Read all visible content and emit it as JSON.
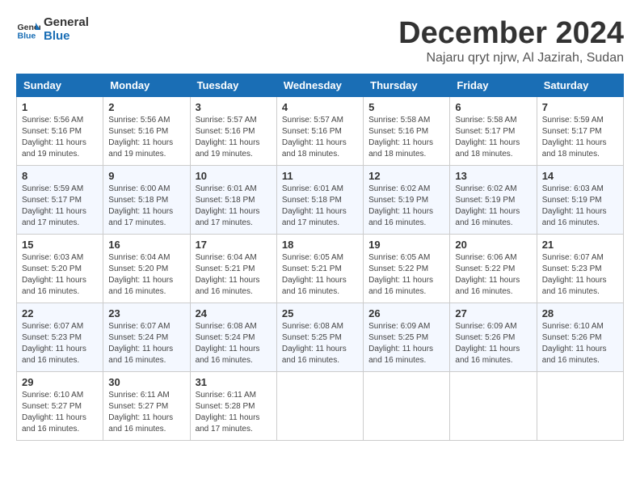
{
  "logo": {
    "text_general": "General",
    "text_blue": "Blue"
  },
  "header": {
    "month": "December 2024",
    "location": "Najaru qryt njrw, Al Jazirah, Sudan"
  },
  "weekdays": [
    "Sunday",
    "Monday",
    "Tuesday",
    "Wednesday",
    "Thursday",
    "Friday",
    "Saturday"
  ],
  "weeks": [
    [
      {
        "day": "1",
        "info": "Sunrise: 5:56 AM\nSunset: 5:16 PM\nDaylight: 11 hours\nand 19 minutes."
      },
      {
        "day": "2",
        "info": "Sunrise: 5:56 AM\nSunset: 5:16 PM\nDaylight: 11 hours\nand 19 minutes."
      },
      {
        "day": "3",
        "info": "Sunrise: 5:57 AM\nSunset: 5:16 PM\nDaylight: 11 hours\nand 19 minutes."
      },
      {
        "day": "4",
        "info": "Sunrise: 5:57 AM\nSunset: 5:16 PM\nDaylight: 11 hours\nand 18 minutes."
      },
      {
        "day": "5",
        "info": "Sunrise: 5:58 AM\nSunset: 5:16 PM\nDaylight: 11 hours\nand 18 minutes."
      },
      {
        "day": "6",
        "info": "Sunrise: 5:58 AM\nSunset: 5:17 PM\nDaylight: 11 hours\nand 18 minutes."
      },
      {
        "day": "7",
        "info": "Sunrise: 5:59 AM\nSunset: 5:17 PM\nDaylight: 11 hours\nand 18 minutes."
      }
    ],
    [
      {
        "day": "8",
        "info": "Sunrise: 5:59 AM\nSunset: 5:17 PM\nDaylight: 11 hours\nand 17 minutes."
      },
      {
        "day": "9",
        "info": "Sunrise: 6:00 AM\nSunset: 5:18 PM\nDaylight: 11 hours\nand 17 minutes."
      },
      {
        "day": "10",
        "info": "Sunrise: 6:01 AM\nSunset: 5:18 PM\nDaylight: 11 hours\nand 17 minutes."
      },
      {
        "day": "11",
        "info": "Sunrise: 6:01 AM\nSunset: 5:18 PM\nDaylight: 11 hours\nand 17 minutes."
      },
      {
        "day": "12",
        "info": "Sunrise: 6:02 AM\nSunset: 5:19 PM\nDaylight: 11 hours\nand 16 minutes."
      },
      {
        "day": "13",
        "info": "Sunrise: 6:02 AM\nSunset: 5:19 PM\nDaylight: 11 hours\nand 16 minutes."
      },
      {
        "day": "14",
        "info": "Sunrise: 6:03 AM\nSunset: 5:19 PM\nDaylight: 11 hours\nand 16 minutes."
      }
    ],
    [
      {
        "day": "15",
        "info": "Sunrise: 6:03 AM\nSunset: 5:20 PM\nDaylight: 11 hours\nand 16 minutes."
      },
      {
        "day": "16",
        "info": "Sunrise: 6:04 AM\nSunset: 5:20 PM\nDaylight: 11 hours\nand 16 minutes."
      },
      {
        "day": "17",
        "info": "Sunrise: 6:04 AM\nSunset: 5:21 PM\nDaylight: 11 hours\nand 16 minutes."
      },
      {
        "day": "18",
        "info": "Sunrise: 6:05 AM\nSunset: 5:21 PM\nDaylight: 11 hours\nand 16 minutes."
      },
      {
        "day": "19",
        "info": "Sunrise: 6:05 AM\nSunset: 5:22 PM\nDaylight: 11 hours\nand 16 minutes."
      },
      {
        "day": "20",
        "info": "Sunrise: 6:06 AM\nSunset: 5:22 PM\nDaylight: 11 hours\nand 16 minutes."
      },
      {
        "day": "21",
        "info": "Sunrise: 6:07 AM\nSunset: 5:23 PM\nDaylight: 11 hours\nand 16 minutes."
      }
    ],
    [
      {
        "day": "22",
        "info": "Sunrise: 6:07 AM\nSunset: 5:23 PM\nDaylight: 11 hours\nand 16 minutes."
      },
      {
        "day": "23",
        "info": "Sunrise: 6:07 AM\nSunset: 5:24 PM\nDaylight: 11 hours\nand 16 minutes."
      },
      {
        "day": "24",
        "info": "Sunrise: 6:08 AM\nSunset: 5:24 PM\nDaylight: 11 hours\nand 16 minutes."
      },
      {
        "day": "25",
        "info": "Sunrise: 6:08 AM\nSunset: 5:25 PM\nDaylight: 11 hours\nand 16 minutes."
      },
      {
        "day": "26",
        "info": "Sunrise: 6:09 AM\nSunset: 5:25 PM\nDaylight: 11 hours\nand 16 minutes."
      },
      {
        "day": "27",
        "info": "Sunrise: 6:09 AM\nSunset: 5:26 PM\nDaylight: 11 hours\nand 16 minutes."
      },
      {
        "day": "28",
        "info": "Sunrise: 6:10 AM\nSunset: 5:26 PM\nDaylight: 11 hours\nand 16 minutes."
      }
    ],
    [
      {
        "day": "29",
        "info": "Sunrise: 6:10 AM\nSunset: 5:27 PM\nDaylight: 11 hours\nand 16 minutes."
      },
      {
        "day": "30",
        "info": "Sunrise: 6:11 AM\nSunset: 5:27 PM\nDaylight: 11 hours\nand 16 minutes."
      },
      {
        "day": "31",
        "info": "Sunrise: 6:11 AM\nSunset: 5:28 PM\nDaylight: 11 hours\nand 17 minutes."
      },
      {
        "day": "",
        "info": ""
      },
      {
        "day": "",
        "info": ""
      },
      {
        "day": "",
        "info": ""
      },
      {
        "day": "",
        "info": ""
      }
    ]
  ]
}
